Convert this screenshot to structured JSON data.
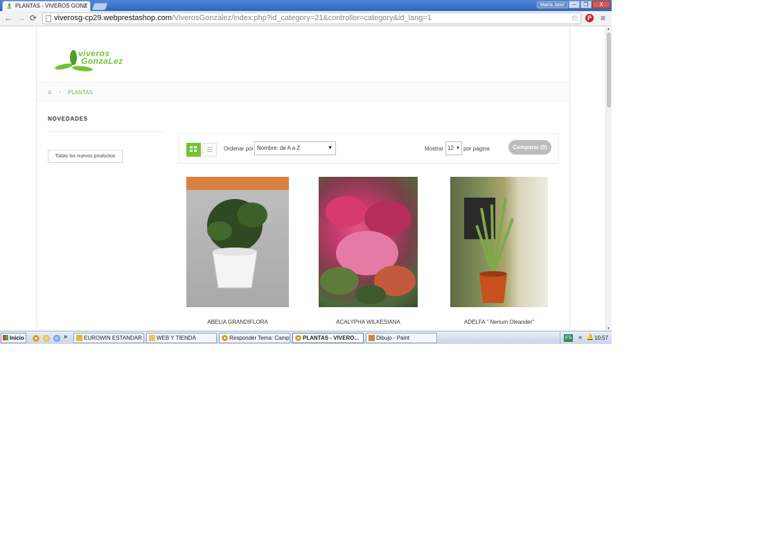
{
  "browser": {
    "tab_title": "PLANTAS - VIVEROS GONZ",
    "tab_close": "×",
    "user_badge": "María José",
    "window_buttons": {
      "minimize": "–",
      "maximize": "❐",
      "close": "X"
    },
    "url_host": "viverosg-cp29.webprestashop.com",
    "url_path": "/ViverosGonzalez/index.php?id_category=21&controller=category&id_lang=1"
  },
  "icons": {
    "back": "back-arrow-icon",
    "forward": "forward-arrow-icon",
    "reload": "reload-icon",
    "star": "star-icon",
    "pinterest": "pinterest-icon",
    "menu": "menu-icon",
    "home": "home-icon"
  },
  "logo": {
    "line1": "viveros",
    "line2": "GonzaLez",
    "color": "#74c335"
  },
  "breadcrumb": {
    "separator": "›",
    "current": "PLANTAS"
  },
  "sidebar": {
    "title": "NOVEDADES",
    "button_label": "Todas los nuevos productos"
  },
  "sortbar": {
    "sort_label": "Ordenar por",
    "sort_value": "Nombre: de A a Z",
    "show_label": "Mostrar",
    "show_value": "12",
    "per_page_label": "por página",
    "compare_label": "Comparar (0)"
  },
  "products": [
    {
      "name": "ABELIA GRANDIFLORA"
    },
    {
      "name": "ACALYPHA WILKESIANA"
    },
    {
      "name": "ADELFA \" Nerium Oleander\""
    }
  ],
  "taskbar": {
    "start_label": "Inicio",
    "quicklaunch_more": "»",
    "tasks": [
      {
        "label": "EUROWIN ESTANDAR ..."
      },
      {
        "label": "WEB Y TIENDA"
      },
      {
        "label": "Responder Tema: Campo..."
      },
      {
        "label": "PLANTAS - VIVERO..."
      },
      {
        "label": "Dibujo - Paint"
      }
    ],
    "lang": "ES",
    "tray_arrows": "«",
    "clock": "10:57"
  },
  "colors": {
    "accent_green": "#74c335",
    "compare_gray": "#bcbcbc"
  }
}
